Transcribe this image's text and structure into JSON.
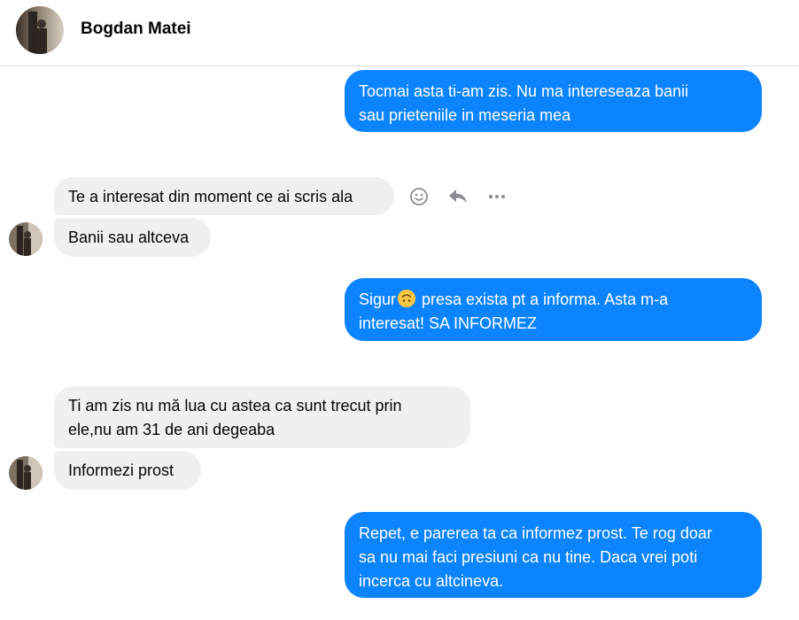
{
  "contact": {
    "name": "Bogdan Matei"
  },
  "messages": {
    "out_1": [
      "Tocmai asta ti-am zis. Nu ma intereseaza banii",
      "sau prieteniile in meseria mea"
    ],
    "in_1": "Te a interesat din moment ce ai scris ala",
    "in_2": "Banii sau altceva",
    "out_2_before_emoji": "Sigur",
    "out_2_after_emoji": " presa exista pt a informa. Asta m-a",
    "out_2_line_2": "interesat! SA INFORMEZ",
    "in_3": [
      "Ti am zis nu mă lua cu astea ca sunt trecut prin",
      "ele,nu am 31 de ani degeaba"
    ],
    "in_4": "Informezi prost",
    "out_3": [
      "Repet, e parerea ta ca informez prost. Te rog doar",
      "sa nu mai faci presiuni ca nu tine. Daca vrei poti",
      "incerca cu altcineva."
    ]
  },
  "icons": {
    "react": "smiley-face-icon",
    "reply": "reply-arrow-icon",
    "more": "more-dots-icon",
    "emoji_in_message": "upside-down-face-emoji"
  },
  "colors": {
    "outgoing_bubble": "#0b84fe",
    "incoming_bubble": "#f0f0f0",
    "icon_gray": "#8a8d91"
  }
}
